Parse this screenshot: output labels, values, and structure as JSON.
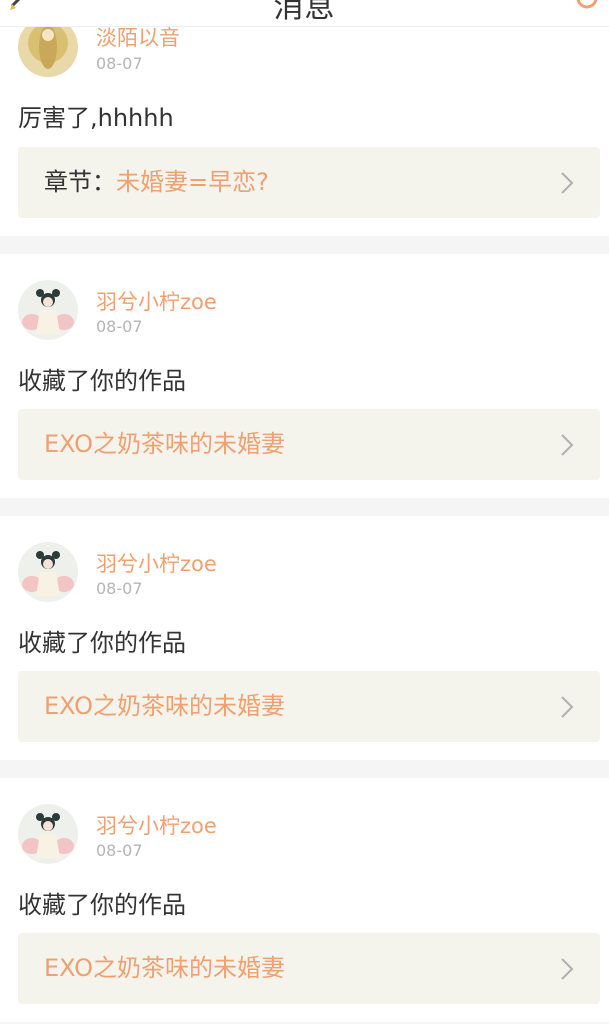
{
  "header": {
    "title": "消息",
    "back_icon": "pencil-back-icon",
    "right_icon": "settings-icon"
  },
  "colors": {
    "accent": "#f0a070",
    "link_bg": "#f4f3ec",
    "page_bg": "#f5f5f5"
  },
  "notifications": [
    {
      "user": "淡陌以音",
      "date": "08-07",
      "message": "厉害了,hhhhh",
      "link_prefix": "章节：",
      "link_title": "未婚妻=早恋?",
      "avatar": "yellow-avatar"
    },
    {
      "user": "羽兮小柠zoe",
      "date": "08-07",
      "message": "收藏了你的作品",
      "link_prefix": "",
      "link_title": "EXO之奶茶味的未婚妻",
      "avatar": "girl-avatar"
    },
    {
      "user": "羽兮小柠zoe",
      "date": "08-07",
      "message": "收藏了你的作品",
      "link_prefix": "",
      "link_title": "EXO之奶茶味的未婚妻",
      "avatar": "girl-avatar"
    },
    {
      "user": "羽兮小柠zoe",
      "date": "08-07",
      "message": "收藏了你的作品",
      "link_prefix": "",
      "link_title": "EXO之奶茶味的未婚妻",
      "avatar": "girl-avatar"
    }
  ]
}
